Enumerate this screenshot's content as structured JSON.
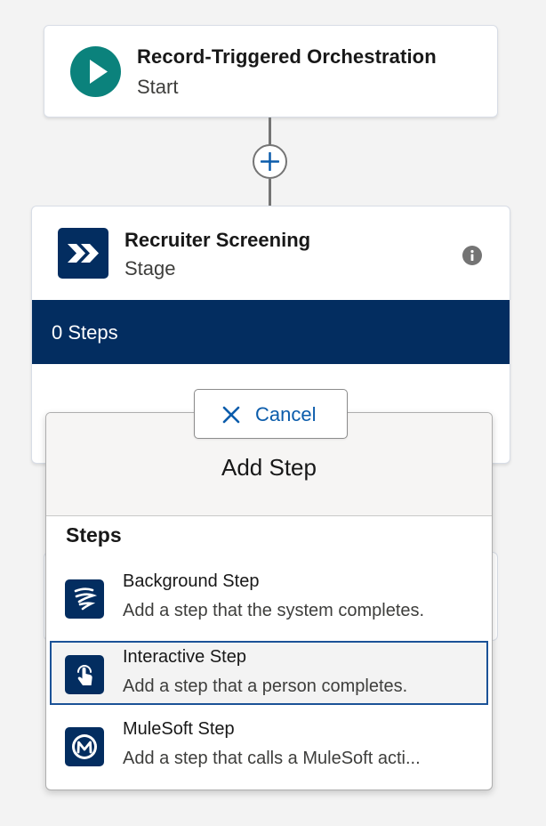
{
  "start_node": {
    "title": "Record-Triggered Orchestration",
    "subtitle": "Start",
    "icon": "play-icon",
    "color": "#0b827c"
  },
  "connector": {
    "add_icon": "plus-icon"
  },
  "stage": {
    "title": "Recruiter Screening",
    "subtitle": "Stage",
    "icon": "chevrons-right-icon",
    "info_icon": "info-icon",
    "steps_count_label": "0 Steps",
    "color": "#032d60"
  },
  "cancel_button": {
    "label": "Cancel",
    "icon": "close-icon",
    "color": "#0b5cab"
  },
  "add_step_panel": {
    "title": "Add Step",
    "section_heading": "Steps",
    "options": [
      {
        "name": "Background Step",
        "description": "Add a step that the system completes.",
        "icon": "wind-icon",
        "selected": false
      },
      {
        "name": "Interactive Step",
        "description": "Add a step that a person completes.",
        "icon": "touch-icon",
        "selected": true
      },
      {
        "name": "MuleSoft Step",
        "description": "Add a step that calls a MuleSoft acti...",
        "icon": "mulesoft-icon",
        "selected": false
      }
    ]
  }
}
